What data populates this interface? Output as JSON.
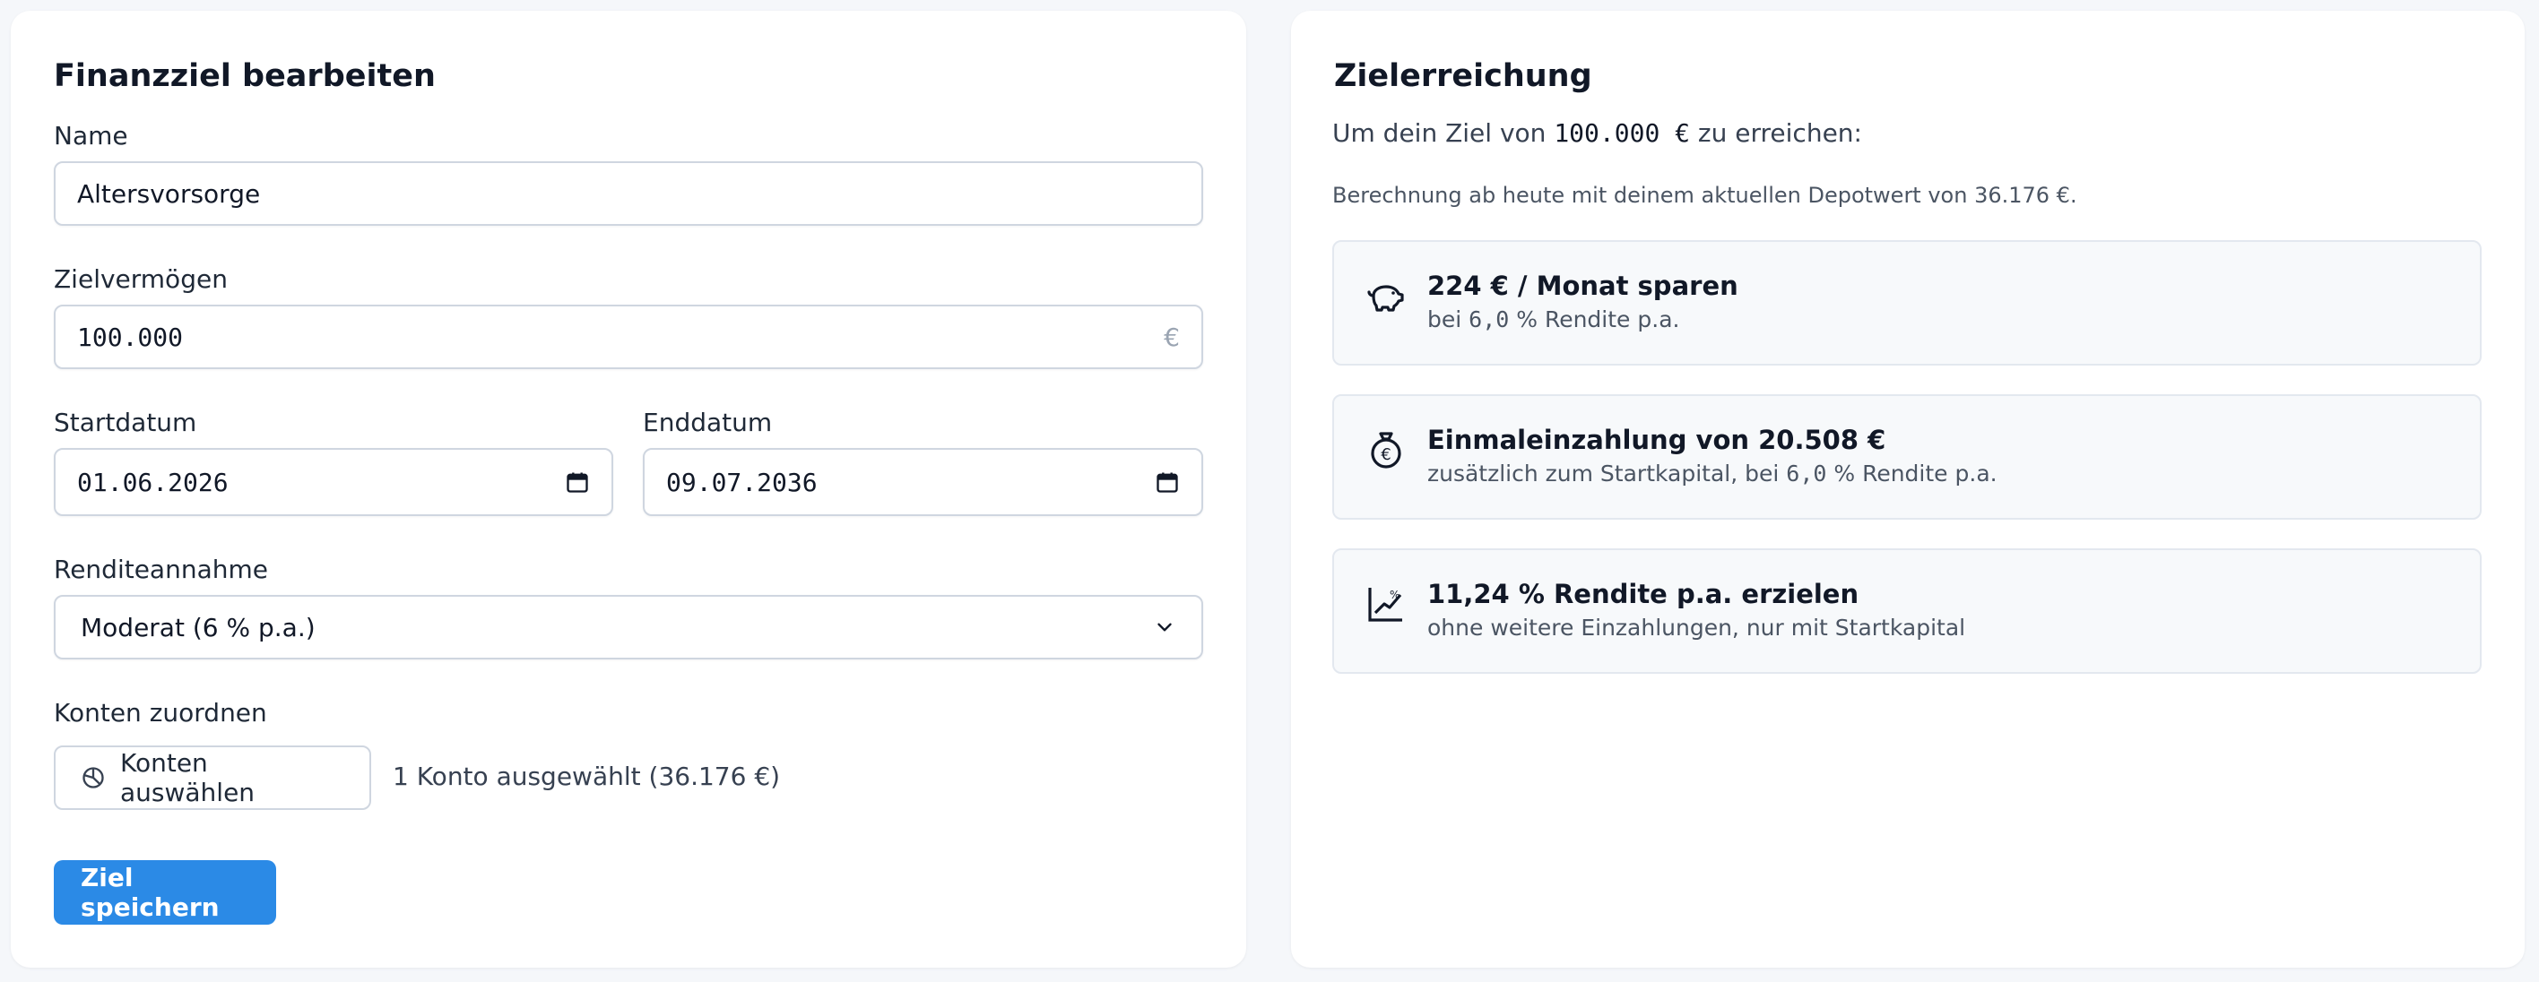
{
  "left": {
    "title": "Finanzziel bearbeiten",
    "name_label": "Name",
    "name_value": "Altersvorsorge",
    "target_label": "Zielvermögen",
    "target_value": "100.000",
    "target_suffix": "€",
    "start_label": "Startdatum",
    "start_value": "01.06.2026",
    "end_label": "Enddatum",
    "end_value": "09.07.2036",
    "return_label": "Renditeannahme",
    "return_value": "Moderat (6 % p.a.)",
    "accounts_label": "Konten zuordnen",
    "accounts_button": "Konten auswählen",
    "accounts_selected": "1 Konto ausgewählt (36.176 €)",
    "save_button": "Ziel speichern"
  },
  "right": {
    "title": "Zielerreichung",
    "intro_prefix": "Um dein Ziel von ",
    "intro_amount": "100.000 €",
    "intro_suffix": " zu erreichen:",
    "note": "Berechnung ab heute mit deinem aktuellen Depotwert von 36.176 €.",
    "options": [
      {
        "icon": "piggy-bank-icon",
        "title": "224 € / Monat sparen",
        "sub_prefix": "bei ",
        "sub_num": "6,0",
        "sub_suffix": " % Rendite p.a."
      },
      {
        "icon": "money-bag-icon",
        "title": "Einmaleinzahlung von 20.508 €",
        "sub_prefix": "zusätzlich zum Startkapital, bei ",
        "sub_num": "6,0",
        "sub_suffix": " % Rendite p.a."
      },
      {
        "icon": "chart-growth-icon",
        "title": "11,24 % Rendite p.a. erzielen",
        "sub_prefix": "ohne weitere Einzahlungen, nur mit Startkapital",
        "sub_num": "",
        "sub_suffix": ""
      }
    ]
  },
  "colors": {
    "primary": "#2b8ae6",
    "background": "#f5f7fa",
    "card": "#ffffff",
    "option_bg": "#f7f9fb"
  }
}
